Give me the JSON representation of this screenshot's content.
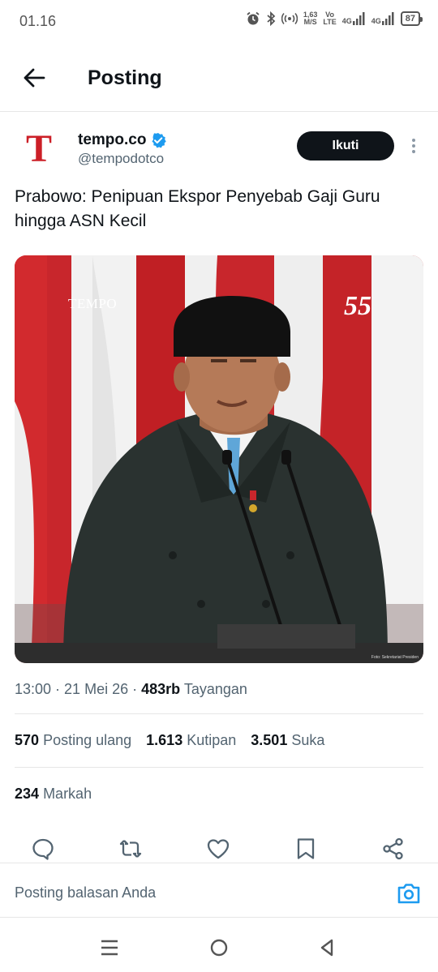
{
  "status_bar": {
    "time": "01.16",
    "speed_value": "1,63",
    "speed_unit": "M/S",
    "volte_top": "Vo",
    "volte_bottom": "LTE",
    "net1": "4G",
    "net2": "4G",
    "battery": "87"
  },
  "header": {
    "title": "Posting"
  },
  "post": {
    "author_name": "tempo.co",
    "author_handle": "@tempodotco",
    "avatar_letter": "T",
    "follow_label": "Ikuti",
    "text": "Prabowo: Penipuan Ekspor Penyebab Gaji Guru hingga ASN Kecil",
    "image_watermark_left": "TEMPO",
    "image_watermark_right": "55",
    "image_credit": "Foto: Sekretariat Presiden",
    "time": "13:00",
    "date": "21 Mei 26",
    "views": "483rb",
    "views_label": "Tayangan",
    "reposts": "570",
    "reposts_label": "Posting ulang",
    "quotes": "1.613",
    "quotes_label": "Kutipan",
    "likes": "3.501",
    "likes_label": "Suka",
    "bookmarks": "234",
    "bookmarks_label": "Markah"
  },
  "reply": {
    "placeholder": "Posting balasan Anda"
  },
  "colors": {
    "accent_blue": "#1d9bf0",
    "brand_red": "#cc1f27",
    "text_primary": "#0f1419",
    "text_secondary": "#536471"
  },
  "icons": [
    "back-arrow-icon",
    "verified-badge-icon",
    "more-icon",
    "reply-icon",
    "repost-icon",
    "like-icon",
    "bookmark-icon",
    "share-icon",
    "camera-icon",
    "recents-icon",
    "home-icon",
    "back-triangle-icon"
  ]
}
